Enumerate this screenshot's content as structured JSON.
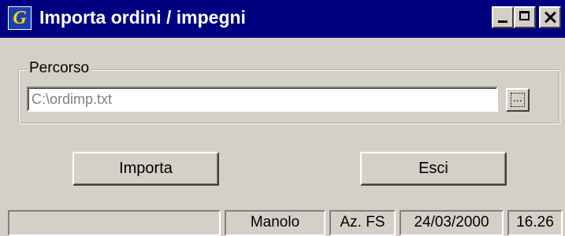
{
  "window": {
    "title": "Importa ordini / impegni",
    "icon": "G"
  },
  "titlebar_buttons": [
    "minimize",
    "maximize",
    "close"
  ],
  "path_group": {
    "label": "Percorso",
    "value": "C:\\ordimp.txt",
    "browse_label": "..."
  },
  "buttons": {
    "import_label": "Importa",
    "exit_label": "Esci"
  },
  "statusbar": {
    "panel0": "",
    "user": "Manolo",
    "company": "Az. FS",
    "date": "24/03/2000",
    "time": "16.26"
  },
  "colors": {
    "titlebar": "#000080",
    "face": "#d4d0c8",
    "disabled_text": "#808080"
  }
}
